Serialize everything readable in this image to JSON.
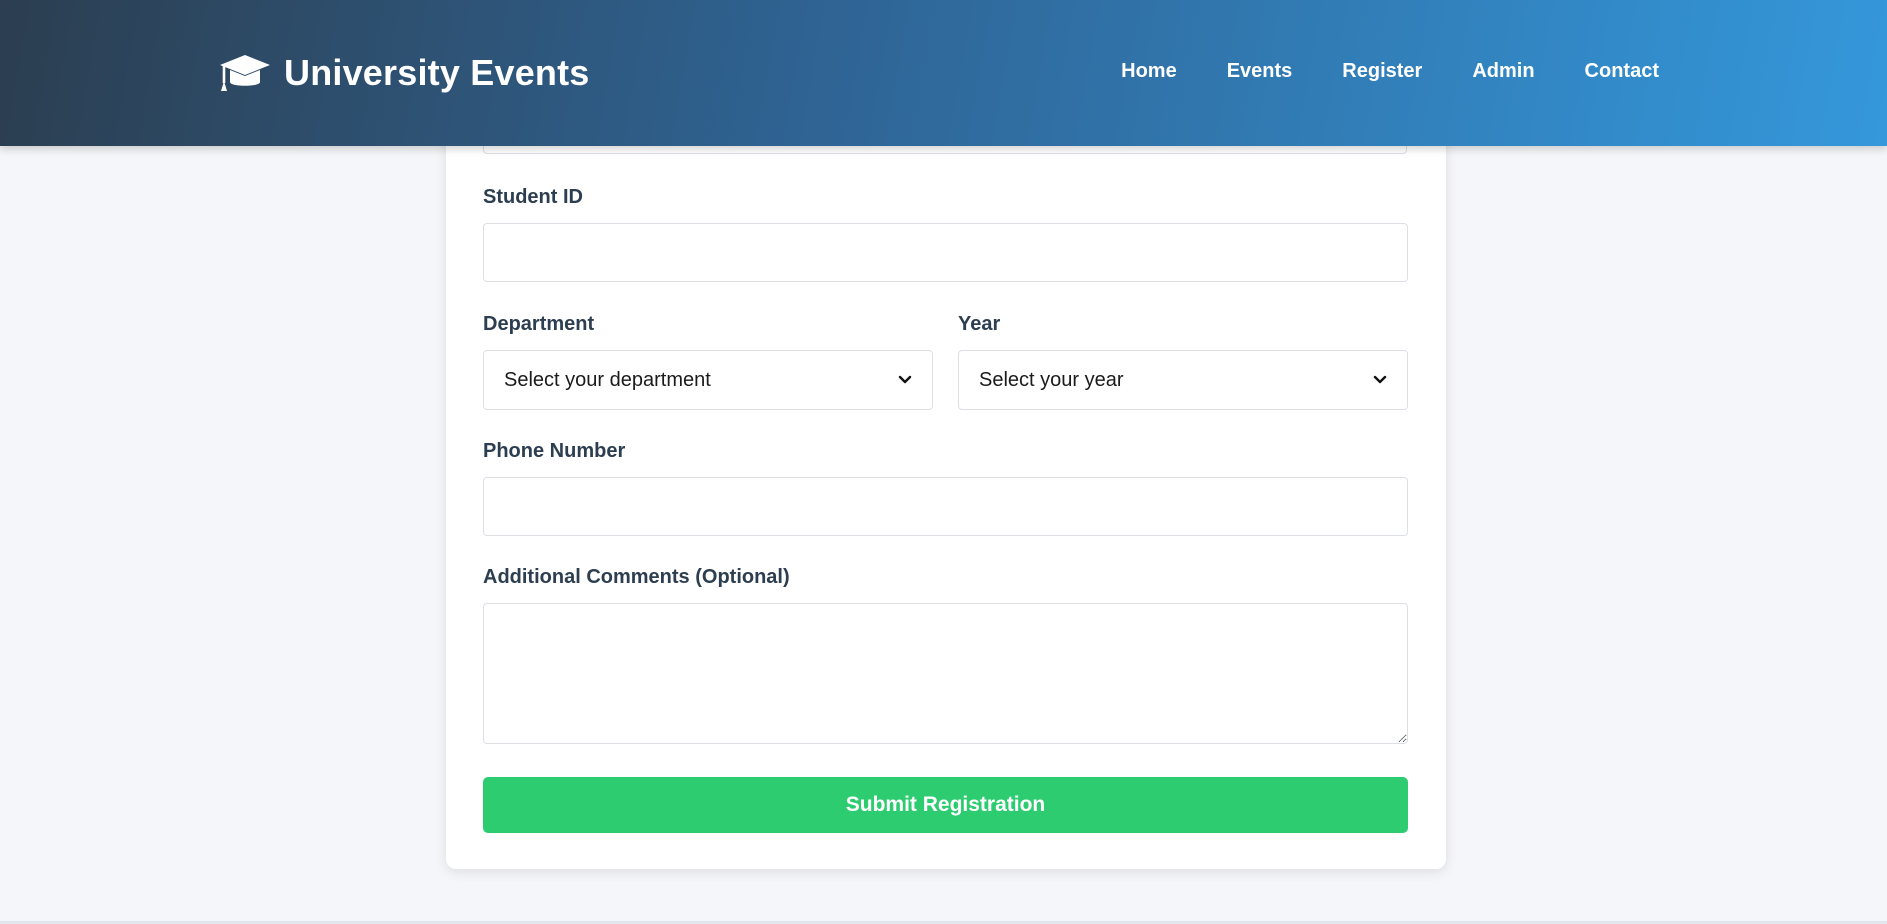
{
  "header": {
    "brand_icon": "graduation-cap-icon",
    "brand_title": "University Events",
    "nav": [
      {
        "label": "Home"
      },
      {
        "label": "Events"
      },
      {
        "label": "Register"
      },
      {
        "label": "Admin"
      },
      {
        "label": "Contact"
      }
    ]
  },
  "form": {
    "student_id": {
      "label": "Student ID",
      "value": ""
    },
    "department": {
      "label": "Department",
      "selected": "Select your department"
    },
    "year": {
      "label": "Year",
      "selected": "Select your year"
    },
    "phone": {
      "label": "Phone Number",
      "value": ""
    },
    "comments": {
      "label": "Additional Comments (Optional)",
      "value": ""
    },
    "submit_label": "Submit Registration"
  },
  "colors": {
    "header_gradient_start": "#2c3e50",
    "header_gradient_end": "#3498db",
    "submit_button": "#2ecc71",
    "page_background": "#f5f6f9",
    "label_text": "#2c3e50"
  }
}
